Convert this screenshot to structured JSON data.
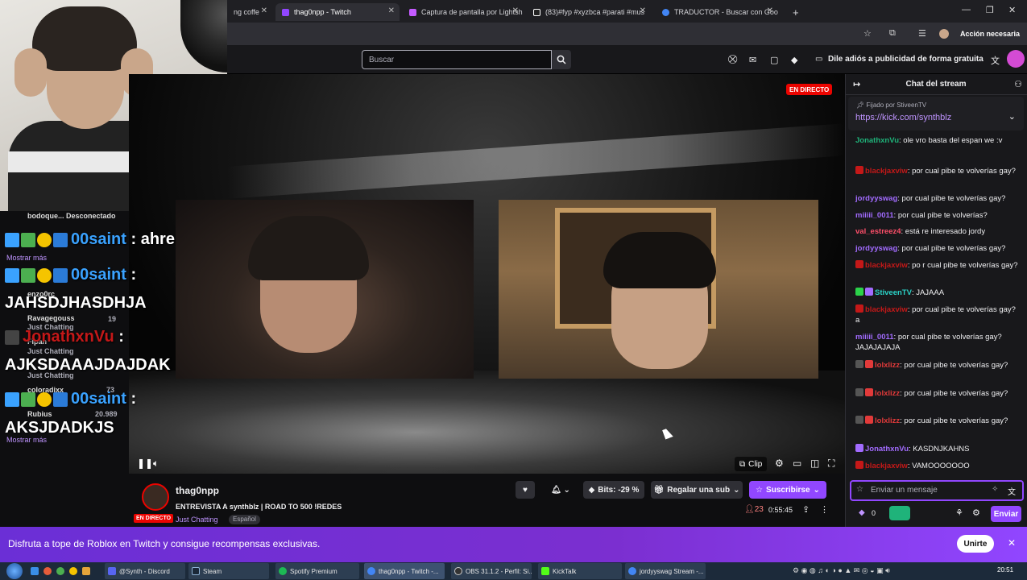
{
  "browser": {
    "tabs": [
      {
        "label": "ng coffe"
      },
      {
        "label": "thag0npp - Twitch"
      },
      {
        "label": "Captura de pantalla por Lightsh"
      },
      {
        "label": "(83)#fyp #xyzbca #parati #mus"
      },
      {
        "label": "TRADUCTOR - Buscar con Goo"
      }
    ],
    "profile_label": "Acción necesaria"
  },
  "twitch": {
    "search_placeholder": "Buscar",
    "ad_free_label": "Dile adiós a publicidad de forma gratuita",
    "live_label": "EN DIRECTO",
    "clip_label": "Clip",
    "streamer": "thag0npp",
    "stream_title": "ENTREVISTA A synthblz | ROAD TO 500 !REDES",
    "category": "Just Chatting",
    "language_tag": "Español",
    "bits_label": "Bits: -29 %",
    "gift_sub_label": "Regalar una sub",
    "subscribe_label": "Suscribirse",
    "viewers": "23",
    "uptime": "0:55:45"
  },
  "overlay": {
    "rows": [
      {
        "user": "00saint",
        "text": ": ahre"
      },
      {
        "more": "Mostrar más"
      },
      {
        "user": "00saint",
        "text": ":"
      },
      {
        "text": "JAHSDJHASDHJA"
      },
      {
        "user": "JonathxnVu",
        "text": ":"
      },
      {
        "text": "AJKSDAAAJDAJDAK"
      },
      {
        "user": "00saint",
        "text": ":"
      },
      {
        "text": "AKSJDADKJS"
      },
      {
        "more": "Mostrar más"
      }
    ],
    "side_list": [
      {
        "name": "bodoque...",
        "sub": "Desconectado"
      },
      {
        "name": "enzo0rc",
        "sub": ""
      },
      {
        "name": "Ravagegouss",
        "sub": "Just Chatting",
        "count": "19"
      },
      {
        "name": "Fipan",
        "sub": "Just Chatting"
      },
      {
        "name": "",
        "sub": "Just Chatting"
      },
      {
        "name": "coloradixx",
        "sub": "",
        "count": "73"
      },
      {
        "name": "Rubius",
        "sub": "",
        "count": "20.989"
      }
    ]
  },
  "chat": {
    "header": "Chat del stream",
    "pinned_by": "Fijado por",
    "pinned_user": "StiveenTV",
    "pinned_link": "https://kick.com/synthblz",
    "messages": [
      {
        "user": "JonathxnVu",
        "color": "#1fb37a",
        "text": ": ole vro basta del espan we :v"
      },
      {
        "user": "blackjaxviw",
        "color": "#c41818",
        "text": ": por cual pibe te volverías gay?"
      },
      {
        "user": "jordyyswag",
        "color": "#a26bff",
        "text": ": por cual pibe te volverías gay?"
      },
      {
        "user": "miiiii_0011",
        "color": "#a26bff",
        "text": ": por cual pibe te volverías?"
      },
      {
        "user": "val_estreez4",
        "color": "#ff4f6a",
        "text": ": está re interesado jordy"
      },
      {
        "user": "jordyyswag",
        "color": "#a26bff",
        "text": ": por cual pibe te volverías gay?"
      },
      {
        "user": "blackjaxviw",
        "color": "#c41818",
        "text": ": po r cual pibe te volverías gay?"
      },
      {
        "user": "StiveenTV",
        "color": "#2bd2c7",
        "text": ": JAJAAA"
      },
      {
        "user": "blackjaxviw",
        "color": "#c41818",
        "text": ": por cual pibe te volverías gay?  a"
      },
      {
        "user": "miiiii_0011",
        "color": "#a26bff",
        "text": ": por cual pibe te volverías gay? JAJAJAJAJA"
      },
      {
        "user": "lolxlizz",
        "color": "#e23a3a",
        "text": ": por cual pibe te volverías gay?"
      },
      {
        "user": "lolxlizz",
        "color": "#e23a3a",
        "text": ": por cual pibe te volverías gay?"
      },
      {
        "user": "lolxlizz",
        "color": "#e23a3a",
        "text": ": por cual pibe te volverías gay?"
      },
      {
        "user": "JonathxnVu",
        "color": "#a26bff",
        "text": ": KASDNJKAHNS"
      },
      {
        "user": "blackjaxviw",
        "color": "#c41818",
        "text": ": VAMOOOOOOO"
      }
    ],
    "input_placeholder": "Enviar un mensaje",
    "points": "0",
    "send_label": "Enviar"
  },
  "banner": {
    "text": "Disfruta a tope de Roblox en Twitch y consigue recompensas exclusivas.",
    "cta": "Unirte"
  },
  "taskbar": {
    "items": [
      {
        "label": "@Synth - Discord"
      },
      {
        "label": "Steam"
      },
      {
        "label": "Spotify Premium"
      },
      {
        "label": "thag0npp - Twitch -..."
      },
      {
        "label": "OBS 31.1.2 - Perfil: Si..."
      },
      {
        "label": "KickTalk"
      },
      {
        "label": "jordyyswag Stream -..."
      }
    ],
    "clock": "20:51"
  }
}
